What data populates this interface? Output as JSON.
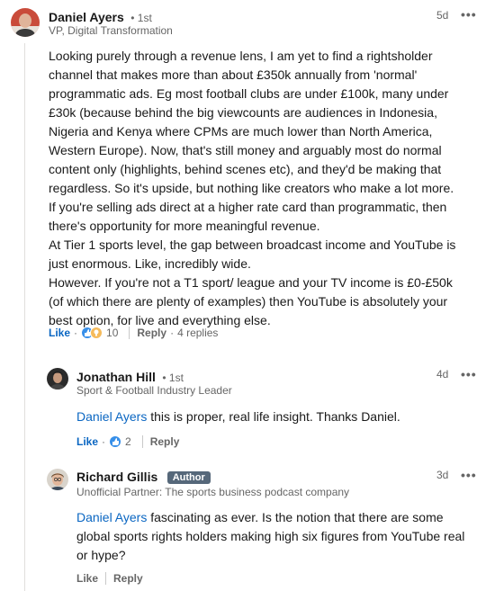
{
  "comments": [
    {
      "author": "Daniel Ayers",
      "degree": "• 1st",
      "headline": "VP, Digital Transformation",
      "age": "5d",
      "more": "•••",
      "lines": [
        "Looking purely through a revenue lens, I am yet to find a rightsholder",
        "channel that makes more than about £350k annually from 'normal'",
        "programmatic ads. Eg most football clubs are under £100k, many under",
        "£30k (because behind the big viewcounts are audiences in Indonesia,",
        "Nigeria and Kenya where CPMs are much lower than North America,",
        "Western Europe). Now, that's still money and arguably most do normal",
        "content only (highlights, behind scenes etc), and they'd be making that",
        "regardless. So it's upside, but nothing like creators who make a lot more.",
        "If you're selling ads direct at a higher rate card than programmatic, then",
        "there's opportunity for more meaningful revenue.",
        "At Tier 1 sports level, the gap between broadcast income and YouTube is",
        "just enormous. Like, incredibly wide.",
        "However. If you're not a T1 sport/ league and your TV income is £0-£50k",
        "(of which there are plenty of examples) then YouTube is absolutely your",
        "best option, for live and everything else."
      ],
      "like_label": "Like",
      "reaction_count": "10",
      "reply_label": "Reply",
      "replies_label": "4 replies"
    },
    {
      "author": "Jonathan Hill",
      "degree": "• 1st",
      "headline": "Sport & Football Industry Leader",
      "age": "4d",
      "more": "•••",
      "mention": "Daniel Ayers",
      "text": " this is proper, real life insight. Thanks Daniel.",
      "like_label": "Like",
      "reaction_count": "2",
      "reply_label": "Reply"
    },
    {
      "author": "Richard Gillis",
      "badge": "Author",
      "headline": "Unofficial Partner: The sports business podcast company",
      "age": "3d",
      "more": "•••",
      "mention": "Daniel Ayers",
      "text_line1": " fascinating as ever. Is the notion that there are some",
      "text_line2": "global sports rights holders making high six figures from YouTube real",
      "text_line3": "or hype?",
      "like_label": "Like",
      "reply_label": "Reply"
    }
  ],
  "separator": "·",
  "colors": {
    "link": "#0a66c2",
    "muted": "#666666",
    "badge": "#56687a"
  }
}
